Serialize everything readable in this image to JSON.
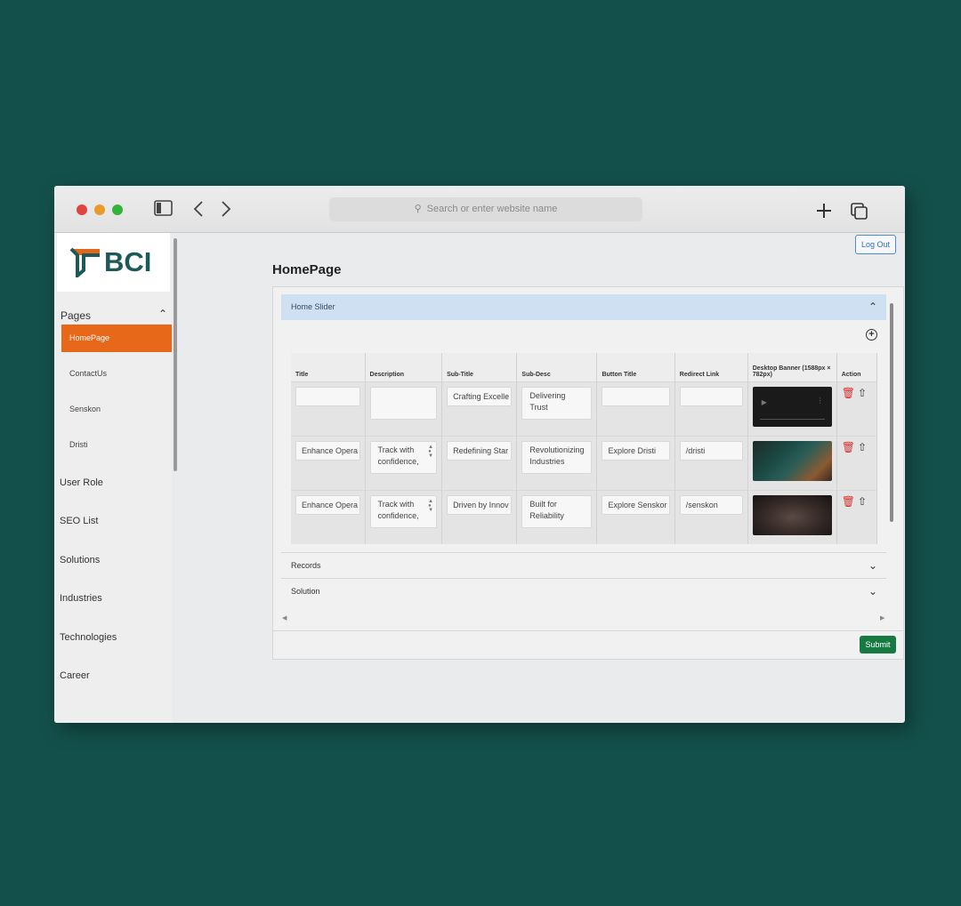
{
  "browser": {
    "address_placeholder": "Search or enter website name"
  },
  "logo": {
    "text": "BCI"
  },
  "sidebar": {
    "pages_label": "Pages",
    "sub_items": [
      "HomePage",
      "ContactUs",
      "Senskon",
      "Dristi"
    ],
    "items": [
      "User Role",
      "SEO List",
      "Solutions",
      "Industries",
      "Technologies",
      "Career"
    ]
  },
  "header": {
    "logout_label": "Log Out"
  },
  "page": {
    "title": "HomePage",
    "section_title": "Home Slider",
    "columns": [
      "Title",
      "Description",
      "Sub-Title",
      "Sub-Desc",
      "Button Title",
      "Redirect Link",
      "Desktop Banner (1588px × 782px)",
      "Action"
    ],
    "rows": [
      {
        "title": "",
        "description": "",
        "subtitle": "Crafting Excelle",
        "subdesc": "Delivering Trust",
        "button_title": "",
        "redirect": "",
        "banner": "video"
      },
      {
        "title": "Enhance Opera",
        "description": "Track with confidence,",
        "subtitle": "Redefining Star",
        "subdesc": "Revolutionizing Industries",
        "button_title": "Explore Dristi",
        "redirect": "/dristi",
        "banner": "image"
      },
      {
        "title": "Enhance Opera",
        "description": "Track with confidence,",
        "subtitle": "Driven by Innov",
        "subdesc": "Built for Reliability",
        "button_title": "Explore Senskor",
        "redirect": "/senskon",
        "banner": "image"
      }
    ],
    "accordions": [
      "Records",
      "Solution"
    ],
    "submit_label": "Submit"
  },
  "colors": {
    "background": "#14504b",
    "accent_active": "#e8681a",
    "submit": "#177a42",
    "delete": "#d9302e",
    "header_band": "#cfe0f2"
  }
}
